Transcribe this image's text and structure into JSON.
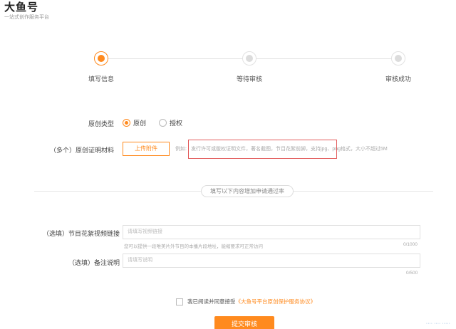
{
  "header": {
    "logo_title": "大鱼号",
    "logo_subtitle": "一站式创作服务平台"
  },
  "steps": [
    {
      "label": "填写信息",
      "active": true
    },
    {
      "label": "等待审核",
      "active": false
    },
    {
      "label": "审核成功",
      "active": false
    }
  ],
  "form": {
    "original_type": {
      "label": "原创类型",
      "options": [
        {
          "label": "原创",
          "checked": true
        },
        {
          "label": "授权",
          "checked": false
        }
      ]
    },
    "proof": {
      "label": "（多个）原创证明材料",
      "upload_label": "上传附件",
      "hint_prefix": "例如:",
      "hint_text": "发行许可或版权证明文件，著名截图，节目花絮前脚，支持jpg、png格式，大小不超过5M"
    },
    "divider_label": "填写以下内容增加申请通过率",
    "video_link": {
      "label": "（选填）节目花絮视频链接",
      "placeholder": "请填写视频链接",
      "hint": "您可以提供一段唯美片外节目的本播片段地址，能缩要求可正常访问",
      "counter": "0/1000"
    },
    "note": {
      "label": "（选填）备注说明",
      "placeholder": "请填写说明",
      "counter": "0/500"
    },
    "agreement": {
      "text": "我已阅读并同意接受",
      "link": "《大鱼号平台原创保护服务协议》"
    },
    "submit_label": "提交审核"
  },
  "footer": {
    "corner_link": "···· ···· ·····"
  },
  "colors": {
    "accent": "#ff8a1e",
    "highlight_box": "#e25a5a"
  }
}
